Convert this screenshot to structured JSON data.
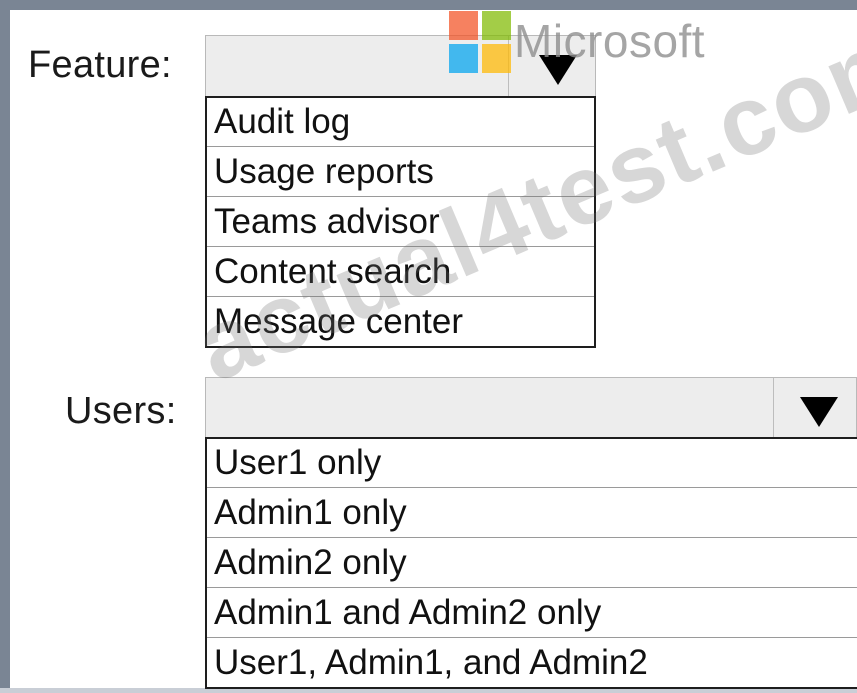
{
  "watermark": {
    "brand_text": "Microsoft",
    "site_text": "actual4test.com",
    "colors": [
      "#f25022",
      "#7fba00",
      "#00a4ef",
      "#ffb900"
    ]
  },
  "feature": {
    "label": "Feature:",
    "options": [
      "Audit log",
      "Usage reports",
      "Teams advisor",
      "Content search",
      "Message center"
    ]
  },
  "users": {
    "label": "Users:",
    "options": [
      "User1 only",
      "Admin1 only",
      "Admin2 only",
      "Admin1 and Admin2 only",
      "User1, Admin1, and Admin2"
    ]
  }
}
